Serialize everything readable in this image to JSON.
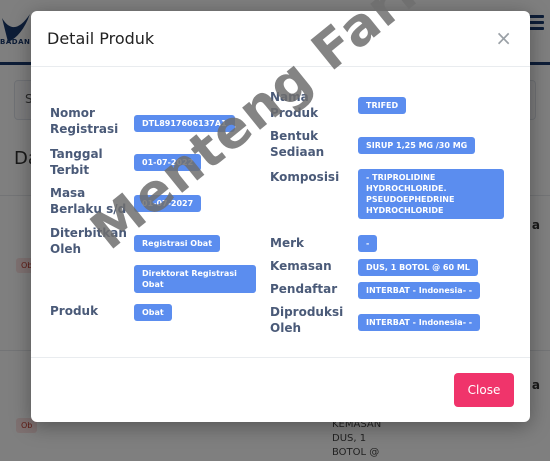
{
  "background": {
    "logo_text": "BADAN",
    "search_letter": "S",
    "title_fragment": "Da",
    "badge_1": "Ob",
    "badge_2": "Ob",
    "right_mark_1": "a",
    "right_mark_2": "a",
    "row_text_lines": [
      "KEMASAN",
      "DUS, 1",
      "BOTOL @"
    ]
  },
  "modal": {
    "title": "Detail Produk",
    "close_icon": "×",
    "close_button": "Close"
  },
  "fields": {
    "nomor_registrasi": {
      "label": "Nomor Registrasi",
      "value": "DTL8917606137A1"
    },
    "tanggal_terbit": {
      "label": "Tanggal Terbit",
      "value": "01-07-2022"
    },
    "masa_berlaku": {
      "label": "Masa Berlaku s/d",
      "value": "01-07-2027"
    },
    "diterbitkan_oleh": {
      "label": "Diterbitkan Oleh",
      "value_1": "Registrasi Obat",
      "value_2": "Direktorat Registrasi Obat"
    },
    "produk": {
      "label": "Produk",
      "value": "Obat"
    },
    "nama_produk": {
      "label": "Nama Produk",
      "value": "TRIFED"
    },
    "bentuk_sediaan": {
      "label": "Bentuk Sediaan",
      "value": "SIRUP 1,25 MG /30 MG"
    },
    "komposisi": {
      "label": "Komposisi",
      "value": "- TRIPROLIDINE HYDROCHLORIDE. PSEUDOEPHEDRINE HYDROCHLORIDE"
    },
    "merk": {
      "label": "Merk",
      "value": "-"
    },
    "kemasan": {
      "label": "Kemasan",
      "value": "DUS, 1 BOTOL @ 60 ML"
    },
    "pendaftar": {
      "label": "Pendaftar",
      "value": "INTERBAT - Indonesia- -"
    },
    "diproduksi_oleh": {
      "label": "Diproduksi Oleh",
      "value": "INTERBAT - Indonesia- -"
    }
  },
  "watermark": "Menteng Farma",
  "colors": {
    "value_badge": "#5b8def",
    "label_text": "#4a5a78",
    "close_button": "#f0346b",
    "header_navy": "#1a3a6e"
  }
}
